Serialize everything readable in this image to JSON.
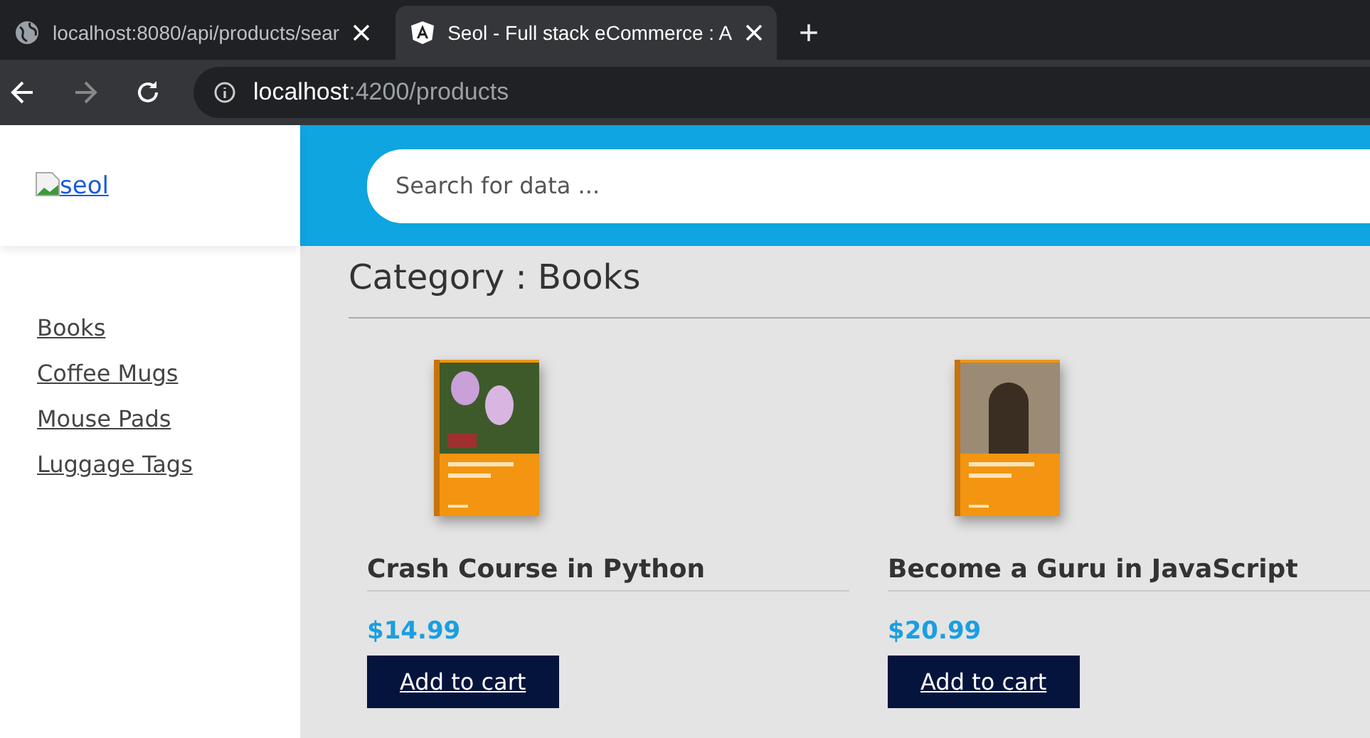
{
  "browser": {
    "tabs": [
      {
        "title": "localhost:8080/api/products/sear",
        "kind": "globe",
        "selected": false
      },
      {
        "title": "Seol - Full stack eCommerce : A",
        "kind": "angular",
        "selected": true
      }
    ],
    "new_tab": "+",
    "address": {
      "host": "localhost",
      "path": ":4200/products"
    }
  },
  "logo": {
    "alt": "seol"
  },
  "sidebar": {
    "items": [
      "Books",
      "Coffee Mugs",
      "Mouse Pads",
      "Luggage Tags"
    ]
  },
  "search": {
    "placeholder": "Search for data ..."
  },
  "category_title": "Category : Books",
  "products": [
    {
      "name": "Crash Course in Python",
      "price": "$14.99",
      "button": "Add to cart",
      "kind": "flowers"
    },
    {
      "name": "Become a Guru in JavaScript",
      "price": "$20.99",
      "button": "Add to cart",
      "kind": "doorway"
    }
  ]
}
